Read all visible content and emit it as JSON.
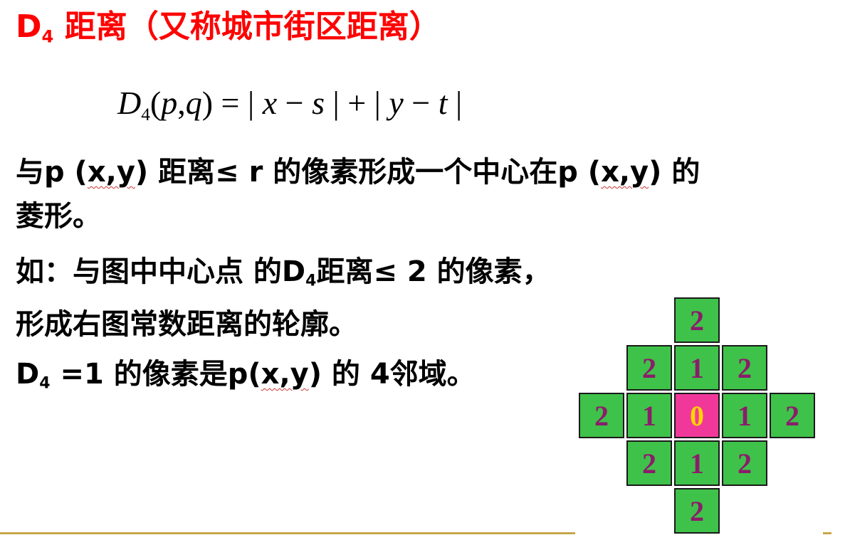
{
  "title": {
    "prefix": "D",
    "sub": "4",
    "rest": " 距离（又称城市街区距离）"
  },
  "formula": {
    "D": "D",
    "sub": "4",
    "lparen": "(",
    "p": "p",
    "comma": ",",
    "q": "q",
    "rparen_eq": ") = | ",
    "x": "x",
    "minus1": " − ",
    "s": "s",
    "mid": " | + | ",
    "y": "y",
    "minus2": " − ",
    "t": "t",
    "end": " |"
  },
  "lines": {
    "l1_a": "与p (",
    "l1_xy": "x,y",
    "l1_b": ") 距离≤  r 的像素形成一个中心在p (",
    "l1_xy2": "x,y",
    "l1_c": ") 的",
    "l2": "菱形。",
    "l3_a": "如：与图中中心点 的D",
    "l3_sub": "4",
    "l3_b": "距离≤  2 的像素，",
    "l4": " 形成右图常数距离的轮廓。",
    "l5_a": "D",
    "l5_sub": "4",
    "l5_b": " =1 的像素是p(",
    "l5_xy": "x,y",
    "l5_c": ") 的 4邻域。"
  },
  "grid": {
    "cells": [
      "2",
      "2",
      "1",
      "2",
      "2",
      "1",
      "0",
      "1",
      "2",
      "2",
      "1",
      "2",
      "2"
    ]
  },
  "colors": {
    "title": "#ff0000",
    "cell_green": "#3fc24a",
    "cell_center": "#f0389a",
    "digit": "#8b1c6b",
    "center_digit": "#ffd400",
    "rule": "#c8a64a"
  }
}
